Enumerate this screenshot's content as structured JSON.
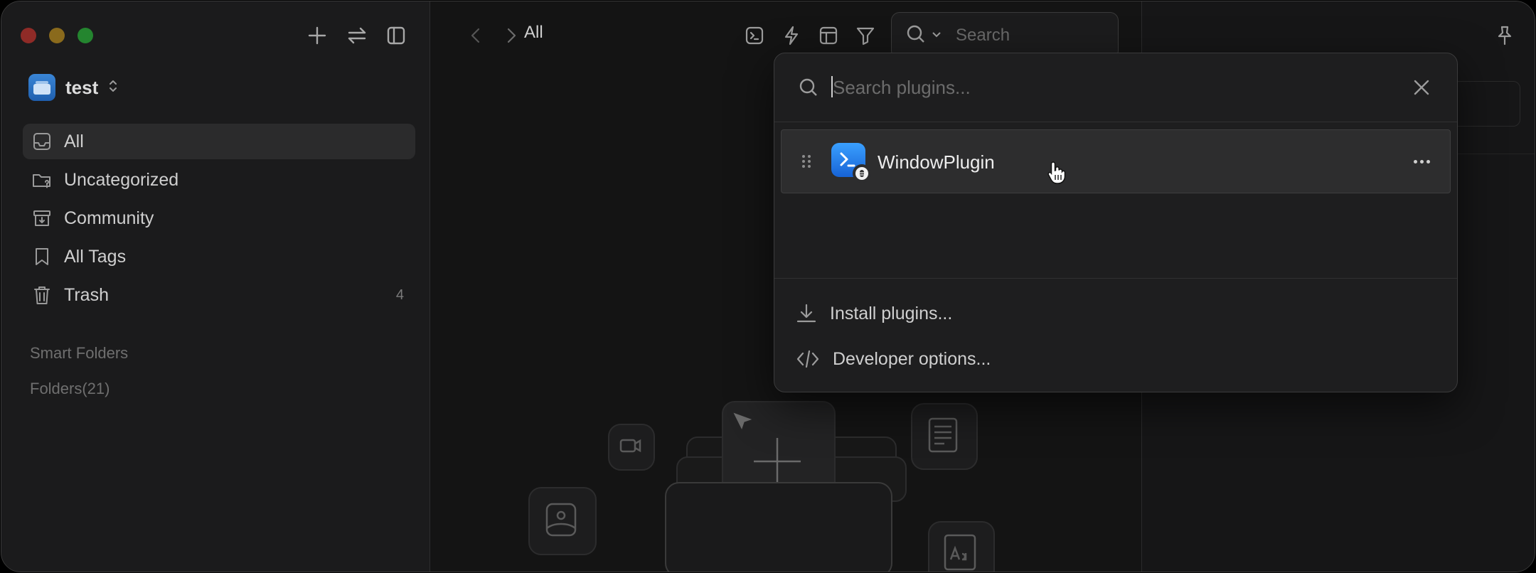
{
  "sidebar": {
    "library_name": "test",
    "items": [
      {
        "label": "All",
        "icon": "inbox-icon",
        "active": true
      },
      {
        "label": "Uncategorized",
        "icon": "folder-question-icon"
      },
      {
        "label": "Community",
        "icon": "archive-icon"
      },
      {
        "label": "All Tags",
        "icon": "bookmark-icon"
      },
      {
        "label": "Trash",
        "icon": "trash-icon",
        "count": "4"
      }
    ],
    "smart_folders_label": "Smart Folders",
    "folders_label": "Folders(21)"
  },
  "toolbar": {
    "breadcrumb": "All",
    "search_placeholder": "Search"
  },
  "plugin_popover": {
    "search_placeholder": "Search plugins...",
    "plugins": [
      {
        "name": "WindowPlugin",
        "icon": "terminal-plugin-icon"
      }
    ],
    "install_label": "Install plugins...",
    "developer_label": "Developer options..."
  },
  "colors": {
    "accent": "#2f7fe0",
    "traffic_red": "#8f2b27",
    "traffic_yellow": "#8a6a1c",
    "traffic_green": "#24852f"
  }
}
